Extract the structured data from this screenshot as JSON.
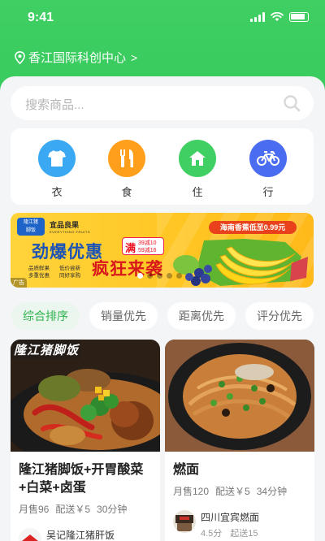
{
  "status_bar": {
    "time": "9:41"
  },
  "location": {
    "label": "香江国际科创中心",
    "chevron": ">"
  },
  "search": {
    "placeholder": "搜索商品..."
  },
  "categories": [
    {
      "label": "衣",
      "icon": "tshirt-icon",
      "color": "#3aa8f2"
    },
    {
      "label": "食",
      "icon": "utensils-icon",
      "color": "#ff9f1c"
    },
    {
      "label": "住",
      "icon": "house-icon",
      "color": "#3fcf63"
    },
    {
      "label": "行",
      "icon": "bicycle-icon",
      "color": "#4a6cf0"
    }
  ],
  "banner": {
    "logo_line1": "隆江猪",
    "logo_line2": "脚饭",
    "brand": "宜品良果",
    "brand_sub": "EVERYTHING FRUITS",
    "headline1": "劲爆优惠",
    "headline2": "疯狂来袭",
    "man_char": "满",
    "man_deal1": "39减10",
    "man_deal2": "59减16",
    "promo": "海南香蕉低至0.99元",
    "small_left1": "品质鲜果",
    "small_left2": "多重优惠",
    "small_right1": "低价尝新",
    "small_right2": "同好享购",
    "ad_tag": "广告",
    "dots_total": 5,
    "dot_active": 1
  },
  "sort_tabs": [
    {
      "label": "综合排序",
      "active": true
    },
    {
      "label": "销量优先",
      "active": false
    },
    {
      "label": "距离优先",
      "active": false
    },
    {
      "label": "评分优先",
      "active": false
    }
  ],
  "cards": [
    {
      "image_label": "隆江猪脚饭",
      "title": "隆江猪脚饭+开胃酸菜+白菜+卤蛋",
      "sold": "月售96",
      "delivery": "配送￥5",
      "time": "30分钟",
      "shop": "吴记隆江猪肝饭",
      "rating": "",
      "min_order": ""
    },
    {
      "image_label": "",
      "title": "燃面",
      "sold": "月售120",
      "delivery": "配送￥5",
      "time": "34分钟",
      "shop": "四川宜宾燃面",
      "rating": "4.5分",
      "min_order": "起送15"
    }
  ]
}
